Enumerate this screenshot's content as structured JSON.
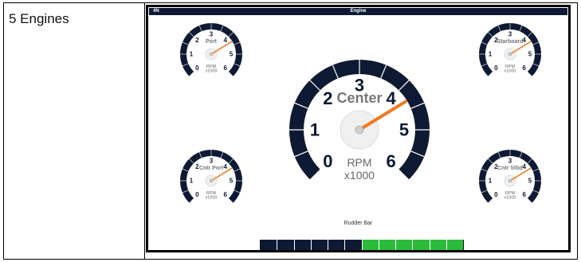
{
  "row_label": "5 Engines",
  "screen": {
    "title_left": "4N",
    "title_center": "Engine"
  },
  "gauges": [
    {
      "id": "port",
      "name": "Port",
      "value": 4.3
    },
    {
      "id": "starboard",
      "name": "Starboard",
      "value": 4.3
    },
    {
      "id": "center",
      "name": "Center",
      "value": 4.3
    },
    {
      "id": "cntr-port",
      "name": "Cntr Port",
      "value": 4.3
    },
    {
      "id": "cntr-stbd",
      "name": "Cntr Stbd",
      "value": 4.3
    }
  ],
  "gauge_scale": {
    "min": 0,
    "max": 6,
    "ticks": [
      "0",
      "1",
      "2",
      "3",
      "4",
      "5",
      "6"
    ],
    "unit_line1": "RPM",
    "unit_line2": "x1000"
  },
  "rudder": {
    "label": "Rudder Bar",
    "segments": 12,
    "active_from_segment": 6
  },
  "colors": {
    "arc": "#0e1a33",
    "needle": "#f07a20",
    "rudder_left": "#0e1a33",
    "rudder_right": "#2bbb3b"
  }
}
